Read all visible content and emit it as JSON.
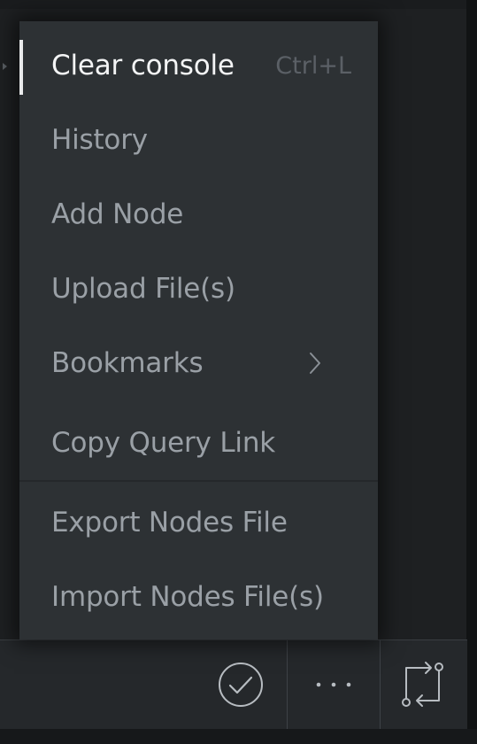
{
  "menu": {
    "items": [
      {
        "label": "Clear console",
        "shortcut": "Ctrl+L",
        "active": true
      },
      {
        "label": "History"
      },
      {
        "label": "Add Node"
      },
      {
        "label": "Upload File(s)"
      },
      {
        "label": "Bookmarks",
        "has_submenu": true,
        "submenu_icon": "chevron-right-icon"
      },
      {
        "label": "Copy Query Link"
      },
      {
        "label": "Export Nodes File"
      },
      {
        "label": "Import Nodes File(s)"
      }
    ]
  },
  "toolbar": {
    "buttons": [
      {
        "icon": "check-circle-icon"
      },
      {
        "icon": "more-dots-icon"
      },
      {
        "icon": "swap-arrows-icon"
      }
    ]
  },
  "colors": {
    "menu_bg": "#2d3134",
    "menu_text": "#9aa0a6",
    "active_text": "#f3f4f5",
    "shortcut_text": "#5b6066",
    "toolbar_bg": "#25282b",
    "icon_stroke": "#b7bcc1"
  }
}
